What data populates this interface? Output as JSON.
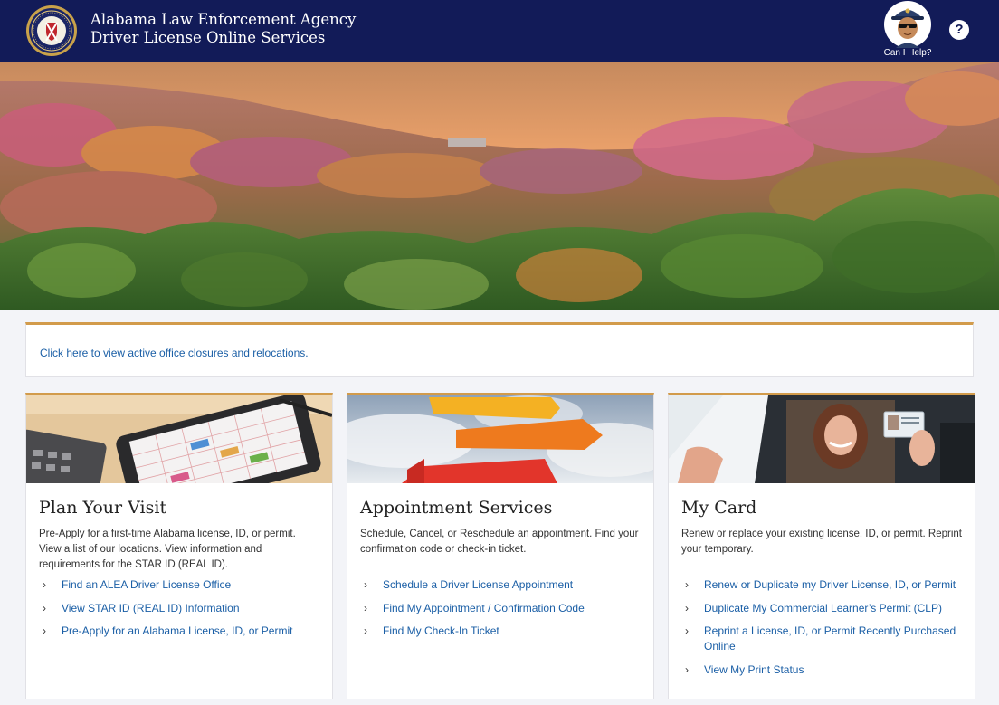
{
  "header": {
    "title_line1": "Alabama Law Enforcement Agency",
    "title_line2": "Driver License Online Services",
    "help_label": "Can I Help?",
    "help_icon_glyph": "?"
  },
  "colors": {
    "header_bg": "#121b58",
    "accent": "#d29b4b",
    "link": "#1b5fa6"
  },
  "notice": {
    "link_text": "Click here to view active office closures and relocations."
  },
  "cards": [
    {
      "title": "Plan Your Visit",
      "description": "Pre-Apply for a first-time Alabama license, ID, or permit. View a list of our locations. View information and requirements for the STAR ID (REAL ID).",
      "links": [
        "Find an ALEA Driver License Office",
        "View STAR ID (REAL ID) Information",
        "Pre-Apply for an Alabama License, ID, or Permit"
      ]
    },
    {
      "title": "Appointment Services",
      "description": "Schedule, Cancel, or Reschedule an appointment. Find your confirmation code or check-in ticket.",
      "links": [
        "Schedule a Driver License Appointment",
        "Find My Appointment / Confirmation Code",
        "Find My Check-In Ticket"
      ]
    },
    {
      "title": "My Card",
      "description": "Renew or replace your existing license, ID, or permit. Reprint your temporary.",
      "links": [
        "Renew or Duplicate my Driver License, ID, or Permit",
        "Duplicate My Commercial Learner’s Permit (CLP)",
        "Reprint a License, ID, or Permit Recently Purchased Online",
        "View My Print Status"
      ]
    }
  ]
}
